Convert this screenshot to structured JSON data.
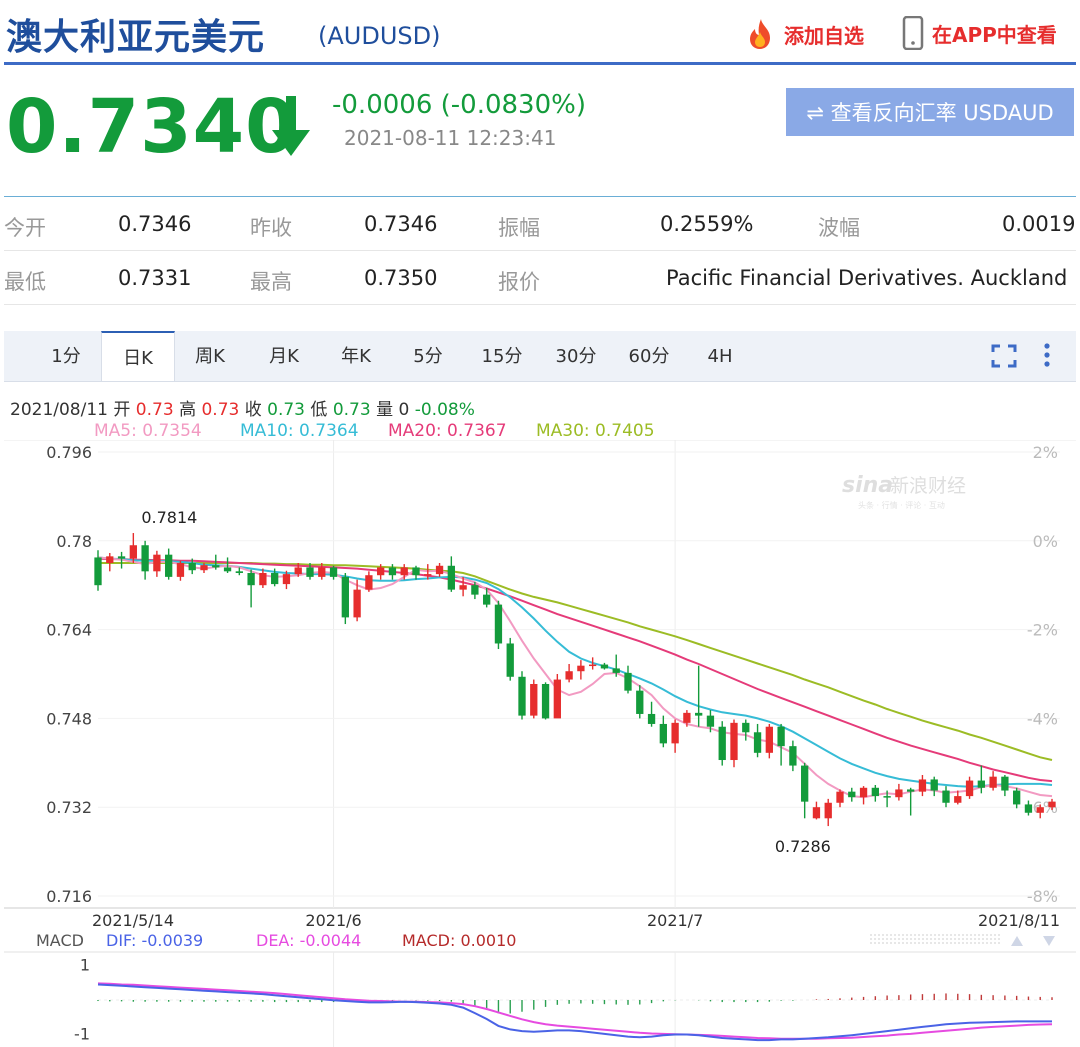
{
  "header": {
    "title": "澳大利亚元美元",
    "code": "(AUDUSD)",
    "add_fav": "添加自选",
    "app_view": "在APP中查看"
  },
  "quote": {
    "price": "0.7340",
    "change": "-0.0006 (-0.0830%)",
    "time": "2021-08-11 12:23:41",
    "reverse_button": "⇌ 查看反向汇率 USDAUD"
  },
  "stats": {
    "open_label": "今开",
    "open": "0.7346",
    "prev_label": "昨收",
    "prev": "0.7346",
    "amp_label": "振幅",
    "amp": "0.2559%",
    "wave_label": "波幅",
    "wave": "0.0019",
    "low_label": "最低",
    "low": "0.7331",
    "high_label": "最高",
    "high": "0.7350",
    "quote_label": "报价",
    "quote_source": "Pacific Financial Derivatives. Auckland"
  },
  "tabs": [
    "1分",
    "日K",
    "周K",
    "月K",
    "年K",
    "5分",
    "15分",
    "30分",
    "60分",
    "4H"
  ],
  "active_tab": "日K",
  "info": {
    "date": "2021/08/11",
    "open_label": "开",
    "open": "0.73",
    "high_label": "高",
    "high": "0.73",
    "close_label": "收",
    "close": "0.73",
    "low_label": "低",
    "low": "0.73",
    "vol_label": "量",
    "vol": "0",
    "pct": "-0.08%"
  },
  "ma": {
    "ma5": "MA5: 0.7354",
    "ma10": "MA10: 0.7364",
    "ma20": "MA20: 0.7367",
    "ma30": "MA30: 0.7405"
  },
  "watermark": {
    "logo": "sina",
    "text": "新浪财经",
    "sub": "头条 · 行情 · 评论 · 互动"
  },
  "macd": {
    "label": "MACD",
    "dif": "DIF: -0.0039",
    "dea": "DEA: -0.0044",
    "macd": "MACD: 0.0010"
  },
  "colors": {
    "up": "#e62d2d",
    "down": "#139b3b",
    "ma5": "#f29ac2",
    "ma10": "#36bcd6",
    "ma20": "#e53b79",
    "ma30": "#9cbc25",
    "dif": "#4a63e6",
    "dea": "#e64be0",
    "macd_text": "#b52a2a",
    "title": "#1f4e9c"
  },
  "icons": {
    "fire": "fire-icon",
    "phone": "phone-icon",
    "arrow": "down-arrow-icon",
    "fullscreen": "fullscreen-icon",
    "more": "more-icon"
  },
  "chart_data": [
    {
      "type": "candlestick",
      "title": "",
      "y_ticks": [
        "0.796",
        "0.78",
        "0.764",
        "0.748",
        "0.732",
        "0.716"
      ],
      "y2_ticks": [
        "2%",
        "0%",
        "-2%",
        "-4%",
        "-6%",
        "-8%"
      ],
      "ylim": [
        0.716,
        0.796
      ],
      "x_ticks": [
        "2021/5/14",
        "2021/6",
        "2021/7",
        "2021/8/11"
      ],
      "x_tick_index": [
        0,
        20,
        49,
        64
      ],
      "annotations": [
        {
          "text": "0.7814",
          "index": 3,
          "value": 0.7814
        },
        {
          "text": "0.7286",
          "index": 59,
          "value": 0.7286
        }
      ],
      "candles": [
        [
          0.777,
          0.772,
          0.7783,
          0.771
        ],
        [
          0.776,
          0.7772,
          0.7778,
          0.7745
        ],
        [
          0.7772,
          0.7768,
          0.778,
          0.775
        ],
        [
          0.7768,
          0.7792,
          0.7814,
          0.776
        ],
        [
          0.7792,
          0.7745,
          0.78,
          0.773
        ],
        [
          0.7745,
          0.7775,
          0.7782,
          0.7735
        ],
        [
          0.7775,
          0.7735,
          0.7786,
          0.773
        ],
        [
          0.7735,
          0.776,
          0.7764,
          0.7728
        ],
        [
          0.776,
          0.7747,
          0.7768,
          0.774
        ],
        [
          0.7747,
          0.7756,
          0.776,
          0.7742
        ],
        [
          0.7756,
          0.7752,
          0.7775,
          0.7748
        ],
        [
          0.7752,
          0.7745,
          0.777,
          0.7742
        ],
        [
          0.7745,
          0.7742,
          0.7752,
          0.7738
        ],
        [
          0.7742,
          0.772,
          0.7748,
          0.768
        ],
        [
          0.772,
          0.7742,
          0.775,
          0.7715
        ],
        [
          0.7742,
          0.7722,
          0.775,
          0.7718
        ],
        [
          0.7722,
          0.774,
          0.7746,
          0.7713
        ],
        [
          0.774,
          0.7752,
          0.776,
          0.7735
        ],
        [
          0.7752,
          0.7735,
          0.776,
          0.773
        ],
        [
          0.7735,
          0.7752,
          0.776,
          0.773
        ],
        [
          0.7752,
          0.7735,
          0.7755,
          0.773
        ],
        [
          0.7735,
          0.7662,
          0.7742,
          0.765
        ],
        [
          0.7662,
          0.7712,
          0.773,
          0.7655
        ],
        [
          0.7712,
          0.7738,
          0.7745,
          0.7708
        ],
        [
          0.7738,
          0.7752,
          0.7758,
          0.773
        ],
        [
          0.7752,
          0.7738,
          0.7758,
          0.773
        ],
        [
          0.7738,
          0.7752,
          0.7758,
          0.773
        ],
        [
          0.7752,
          0.7738,
          0.7755,
          0.773
        ],
        [
          0.7738,
          0.774,
          0.7758,
          0.773
        ],
        [
          0.774,
          0.7755,
          0.776,
          0.7735
        ],
        [
          0.7755,
          0.7712,
          0.7772,
          0.7708
        ],
        [
          0.7712,
          0.772,
          0.7735,
          0.77
        ],
        [
          0.772,
          0.7703,
          0.7726,
          0.7695
        ],
        [
          0.7703,
          0.7685,
          0.7715,
          0.768
        ],
        [
          0.7685,
          0.7615,
          0.7692,
          0.7605
        ],
        [
          0.7615,
          0.7555,
          0.7625,
          0.7548
        ],
        [
          0.7555,
          0.7485,
          0.7565,
          0.7478
        ],
        [
          0.7485,
          0.7542,
          0.755,
          0.748
        ],
        [
          0.7542,
          0.748,
          0.7545,
          0.7478
        ],
        [
          0.748,
          0.755,
          0.756,
          0.749
        ],
        [
          0.755,
          0.7565,
          0.7578,
          0.7545
        ],
        [
          0.7565,
          0.7575,
          0.7585,
          0.755
        ],
        [
          0.7575,
          0.7577,
          0.759,
          0.7568
        ],
        [
          0.7577,
          0.757,
          0.758,
          0.7568
        ],
        [
          0.757,
          0.7562,
          0.7595,
          0.7555
        ],
        [
          0.7562,
          0.753,
          0.7575,
          0.7525
        ],
        [
          0.753,
          0.7488,
          0.754,
          0.748
        ],
        [
          0.7488,
          0.747,
          0.751,
          0.7465
        ],
        [
          0.747,
          0.7435,
          0.7485,
          0.7428
        ],
        [
          0.7435,
          0.7472,
          0.7478,
          0.7418
        ],
        [
          0.7472,
          0.749,
          0.7495,
          0.7465
        ],
        [
          0.749,
          0.7485,
          0.7575,
          0.7465
        ],
        [
          0.7485,
          0.7465,
          0.7495,
          0.7455
        ],
        [
          0.7465,
          0.7405,
          0.7475,
          0.7395
        ],
        [
          0.7405,
          0.7472,
          0.7478,
          0.7392
        ],
        [
          0.7472,
          0.7455,
          0.7478,
          0.744
        ],
        [
          0.7455,
          0.7418,
          0.747,
          0.741
        ],
        [
          0.7418,
          0.7465,
          0.747,
          0.7408
        ],
        [
          0.7465,
          0.743,
          0.747,
          0.7395
        ],
        [
          0.743,
          0.7395,
          0.744,
          0.7385
        ],
        [
          0.7395,
          0.733,
          0.74,
          0.73
        ],
        [
          0.73,
          0.732,
          0.733,
          0.7298
        ],
        [
          0.73,
          0.7328,
          0.7335,
          0.7286
        ],
        [
          0.7328,
          0.7348,
          0.7352,
          0.732
        ],
        [
          0.7348,
          0.7338,
          0.7355,
          0.733
        ],
        [
          0.7338,
          0.7355,
          0.7358,
          0.7325
        ],
        [
          0.7355,
          0.734,
          0.736,
          0.733
        ],
        [
          0.734,
          0.7338,
          0.735,
          0.732
        ],
        [
          0.7338,
          0.7352,
          0.7362,
          0.7332
        ],
        [
          0.7352,
          0.7348,
          0.7355,
          0.7305
        ],
        [
          0.7348,
          0.737,
          0.7378,
          0.734
        ],
        [
          0.737,
          0.735,
          0.7375,
          0.734
        ],
        [
          0.735,
          0.7328,
          0.7358,
          0.732
        ],
        [
          0.7328,
          0.734,
          0.735,
          0.7325
        ],
        [
          0.734,
          0.7368,
          0.7375,
          0.7335
        ],
        [
          0.7368,
          0.7355,
          0.7395,
          0.7345
        ],
        [
          0.7355,
          0.7375,
          0.7385,
          0.735
        ],
        [
          0.7375,
          0.735,
          0.7378,
          0.734
        ],
        [
          0.735,
          0.7325,
          0.7355,
          0.7318
        ],
        [
          0.7325,
          0.731,
          0.7332,
          0.7305
        ],
        [
          0.731,
          0.732,
          0.7325,
          0.73
        ],
        [
          0.732,
          0.733,
          0.7335,
          0.7315
        ]
      ],
      "ma5": [
        0.777,
        0.7768,
        0.7766,
        0.7762,
        0.7758,
        0.7762,
        0.7762,
        0.7758,
        0.7752,
        0.775,
        0.7753,
        0.7755,
        0.7752,
        0.7745,
        0.7738,
        0.7735,
        0.7736,
        0.7738,
        0.7742,
        0.7744,
        0.7742,
        0.773,
        0.772,
        0.7712,
        0.7715,
        0.7722,
        0.7735,
        0.7748,
        0.7745,
        0.7746,
        0.774,
        0.7732,
        0.7725,
        0.7712,
        0.7688,
        0.7655,
        0.762,
        0.7588,
        0.756,
        0.7532,
        0.7522,
        0.7528,
        0.7542,
        0.756,
        0.7562,
        0.7552,
        0.7538,
        0.7522,
        0.7498,
        0.748,
        0.747,
        0.7465,
        0.7462,
        0.7455,
        0.7452,
        0.745,
        0.7442,
        0.7438,
        0.7428,
        0.7418,
        0.7398,
        0.7378,
        0.7362,
        0.735,
        0.734,
        0.7338,
        0.7342,
        0.7345,
        0.7343,
        0.7348,
        0.7352,
        0.735,
        0.7346,
        0.7348,
        0.735,
        0.7356,
        0.736,
        0.7358,
        0.7354,
        0.7348,
        0.7342,
        0.734
      ],
      "ma10": [
        0.777,
        0.7768,
        0.7767,
        0.7765,
        0.7764,
        0.7764,
        0.7763,
        0.7762,
        0.776,
        0.7757,
        0.7756,
        0.7755,
        0.7753,
        0.775,
        0.7747,
        0.7744,
        0.7742,
        0.7741,
        0.774,
        0.774,
        0.7739,
        0.7736,
        0.7732,
        0.7729,
        0.7728,
        0.7728,
        0.7729,
        0.7731,
        0.7732,
        0.7734,
        0.7735,
        0.7734,
        0.773,
        0.7724,
        0.7713,
        0.7698,
        0.768,
        0.766,
        0.7638,
        0.7618,
        0.76,
        0.7588,
        0.758,
        0.7574,
        0.7568,
        0.756,
        0.7552,
        0.7543,
        0.7532,
        0.752,
        0.751,
        0.7502,
        0.7496,
        0.7491,
        0.7488,
        0.7485,
        0.748,
        0.7474,
        0.7466,
        0.7456,
        0.7444,
        0.7432,
        0.742,
        0.7408,
        0.7398,
        0.739,
        0.7382,
        0.7376,
        0.7371,
        0.7368,
        0.7365,
        0.7362,
        0.736,
        0.7358,
        0.7357,
        0.7358,
        0.736,
        0.7361,
        0.7362,
        0.7362,
        0.7362,
        0.736
      ],
      "ma20": [
        0.7768,
        0.7767,
        0.7767,
        0.7766,
        0.7766,
        0.7765,
        0.7765,
        0.7764,
        0.7764,
        0.7763,
        0.7762,
        0.7761,
        0.776,
        0.7759,
        0.7758,
        0.7757,
        0.7756,
        0.7755,
        0.7754,
        0.7753,
        0.7752,
        0.7751,
        0.775,
        0.7748,
        0.7746,
        0.7744,
        0.7742,
        0.774,
        0.7737,
        0.7734,
        0.773,
        0.7725,
        0.772,
        0.7714,
        0.7707,
        0.77,
        0.7692,
        0.7684,
        0.7676,
        0.7668,
        0.7661,
        0.7654,
        0.7647,
        0.764,
        0.7633,
        0.7626,
        0.7619,
        0.7611,
        0.7603,
        0.7595,
        0.7586,
        0.7578,
        0.7569,
        0.756,
        0.7551,
        0.7542,
        0.7533,
        0.7525,
        0.7517,
        0.7509,
        0.7501,
        0.7493,
        0.7485,
        0.7477,
        0.7469,
        0.7461,
        0.7453,
        0.7445,
        0.7438,
        0.7431,
        0.7425,
        0.7419,
        0.7413,
        0.7407,
        0.74,
        0.7394,
        0.7388,
        0.7383,
        0.7378,
        0.7373,
        0.7369,
        0.7367
      ],
      "ma30": [
        0.776,
        0.776,
        0.776,
        0.776,
        0.776,
        0.776,
        0.776,
        0.776,
        0.776,
        0.776,
        0.776,
        0.776,
        0.776,
        0.776,
        0.7759,
        0.7759,
        0.7758,
        0.7758,
        0.7757,
        0.7757,
        0.7756,
        0.7756,
        0.7755,
        0.7754,
        0.7753,
        0.7752,
        0.7751,
        0.775,
        0.7748,
        0.7746,
        0.7745,
        0.7742,
        0.7736,
        0.7728,
        0.772,
        0.7712,
        0.7705,
        0.7699,
        0.7694,
        0.7689,
        0.7683,
        0.7677,
        0.7671,
        0.7665,
        0.7659,
        0.7653,
        0.7646,
        0.764,
        0.7634,
        0.7628,
        0.7621,
        0.7614,
        0.7607,
        0.76,
        0.7593,
        0.7586,
        0.7579,
        0.7572,
        0.7565,
        0.7558,
        0.755,
        0.7543,
        0.7536,
        0.7528,
        0.752,
        0.7512,
        0.7505,
        0.7497,
        0.749,
        0.7483,
        0.7476,
        0.747,
        0.7464,
        0.7458,
        0.7451,
        0.7445,
        0.7438,
        0.7431,
        0.7424,
        0.7417,
        0.741,
        0.7405
      ]
    },
    {
      "type": "macd",
      "y_ticks": [
        "1",
        "-1"
      ],
      "ylim": [
        -1.1,
        1.1
      ],
      "dif": [
        0.45,
        0.43,
        0.41,
        0.39,
        0.37,
        0.35,
        0.33,
        0.31,
        0.29,
        0.27,
        0.25,
        0.23,
        0.21,
        0.19,
        0.17,
        0.14,
        0.11,
        0.08,
        0.05,
        0.02,
        -0.01,
        -0.03,
        -0.05,
        -0.07,
        -0.07,
        -0.06,
        -0.05,
        -0.06,
        -0.08,
        -0.1,
        -0.14,
        -0.22,
        -0.38,
        -0.55,
        -0.75,
        -0.85,
        -0.9,
        -0.92,
        -0.9,
        -0.88,
        -0.88,
        -0.9,
        -0.94,
        -0.98,
        -1.02,
        -1.06,
        -1.08,
        -1.06,
        -1.02,
        -1.0,
        -1.0,
        -1.02,
        -1.06,
        -1.1,
        -1.12,
        -1.14,
        -1.16,
        -1.16,
        -1.14,
        -1.14,
        -1.12,
        -1.1,
        -1.08,
        -1.05,
        -1.02,
        -0.98,
        -0.94,
        -0.9,
        -0.86,
        -0.82,
        -0.78,
        -0.74,
        -0.7,
        -0.68,
        -0.66,
        -0.65,
        -0.64,
        -0.63,
        -0.62,
        -0.62,
        -0.62,
        -0.62
      ],
      "dea": [
        0.48,
        0.47,
        0.45,
        0.44,
        0.42,
        0.4,
        0.38,
        0.36,
        0.34,
        0.32,
        0.3,
        0.28,
        0.26,
        0.24,
        0.22,
        0.2,
        0.17,
        0.14,
        0.11,
        0.08,
        0.05,
        0.02,
        0.0,
        -0.02,
        -0.03,
        -0.04,
        -0.05,
        -0.05,
        -0.06,
        -0.07,
        -0.09,
        -0.12,
        -0.18,
        -0.26,
        -0.36,
        -0.46,
        -0.56,
        -0.64,
        -0.7,
        -0.74,
        -0.77,
        -0.8,
        -0.83,
        -0.86,
        -0.89,
        -0.92,
        -0.95,
        -0.97,
        -0.98,
        -0.99,
        -1.0,
        -1.01,
        -1.02,
        -1.04,
        -1.06,
        -1.08,
        -1.1,
        -1.11,
        -1.12,
        -1.12,
        -1.12,
        -1.12,
        -1.11,
        -1.1,
        -1.09,
        -1.07,
        -1.05,
        -1.03,
        -1.0,
        -0.98,
        -0.95,
        -0.92,
        -0.89,
        -0.86,
        -0.83,
        -0.8,
        -0.78,
        -0.76,
        -0.74,
        -0.72,
        -0.71,
        -0.7
      ]
    }
  ]
}
